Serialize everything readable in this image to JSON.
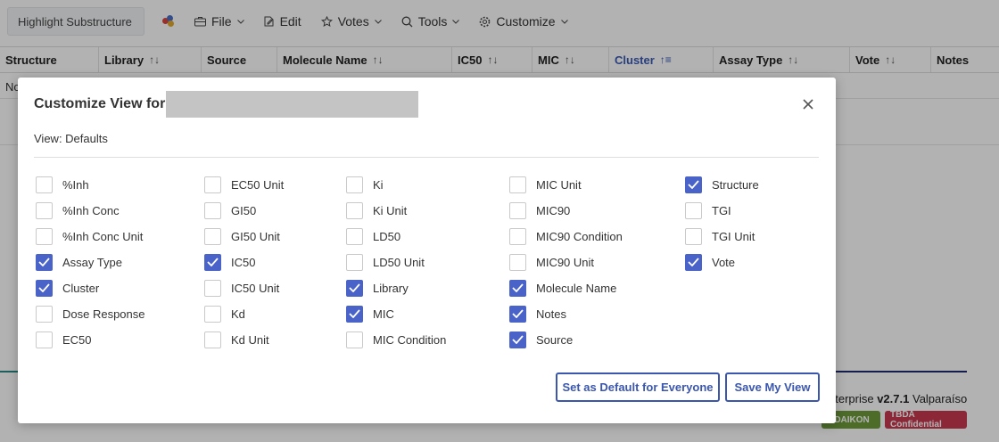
{
  "toolbar": {
    "search_label": "Highlight Substructure",
    "menus": [
      {
        "label": "File",
        "icon": "briefcase-icon"
      },
      {
        "label": "Edit",
        "icon": "edit-icon"
      },
      {
        "label": "Votes",
        "icon": "star-icon"
      },
      {
        "label": "Tools",
        "icon": "search-icon"
      },
      {
        "label": "Customize",
        "icon": "gear-icon"
      }
    ]
  },
  "table": {
    "columns": [
      "Structure",
      "Library",
      "Source",
      "Molecule Name",
      "IC50",
      "MIC",
      "Cluster",
      "Assay Type",
      "Vote",
      "Notes"
    ],
    "active_sort_column": "Cluster",
    "row_text": "No"
  },
  "footer": {
    "brand_prefix": "nterprise",
    "version": "v2.7.1",
    "release": "Valparaíso",
    "badge_green": "e DAIKON",
    "badge_red": "TBDA Confidential"
  },
  "modal": {
    "title": "Customize View for",
    "view_label": "View: Defaults",
    "columns": [
      [
        {
          "label": "%Inh",
          "checked": false
        },
        {
          "label": "%Inh Conc",
          "checked": false
        },
        {
          "label": "%Inh Conc Unit",
          "checked": false
        },
        {
          "label": "Assay Type",
          "checked": true
        },
        {
          "label": "Cluster",
          "checked": true
        },
        {
          "label": "Dose Response",
          "checked": false
        },
        {
          "label": "EC50",
          "checked": false
        }
      ],
      [
        {
          "label": "EC50 Unit",
          "checked": false
        },
        {
          "label": "GI50",
          "checked": false
        },
        {
          "label": "GI50 Unit",
          "checked": false
        },
        {
          "label": "IC50",
          "checked": true
        },
        {
          "label": "IC50 Unit",
          "checked": false
        },
        {
          "label": "Kd",
          "checked": false
        },
        {
          "label": "Kd Unit",
          "checked": false
        }
      ],
      [
        {
          "label": "Ki",
          "checked": false
        },
        {
          "label": "Ki Unit",
          "checked": false
        },
        {
          "label": "LD50",
          "checked": false
        },
        {
          "label": "LD50 Unit",
          "checked": false
        },
        {
          "label": "Library",
          "checked": true
        },
        {
          "label": "MIC",
          "checked": true
        },
        {
          "label": "MIC Condition",
          "checked": false
        }
      ],
      [
        {
          "label": "MIC Unit",
          "checked": false
        },
        {
          "label": "MIC90",
          "checked": false
        },
        {
          "label": "MIC90 Condition",
          "checked": false
        },
        {
          "label": "MIC90 Unit",
          "checked": false
        },
        {
          "label": "Molecule Name",
          "checked": true
        },
        {
          "label": "Notes",
          "checked": true
        },
        {
          "label": "Source",
          "checked": true
        }
      ],
      [
        {
          "label": "Structure",
          "checked": true
        },
        {
          "label": "TGI",
          "checked": false
        },
        {
          "label": "TGI Unit",
          "checked": false
        },
        {
          "label": "Vote",
          "checked": true
        }
      ]
    ],
    "buttons": {
      "set_default": "Set as Default for Everyone",
      "save_view": "Save My View"
    }
  },
  "colors": {
    "accent": "#4a63c8",
    "button_border": "#3b56ad",
    "badge_green": "#6e9b3a",
    "badge_red": "#c8394f"
  }
}
